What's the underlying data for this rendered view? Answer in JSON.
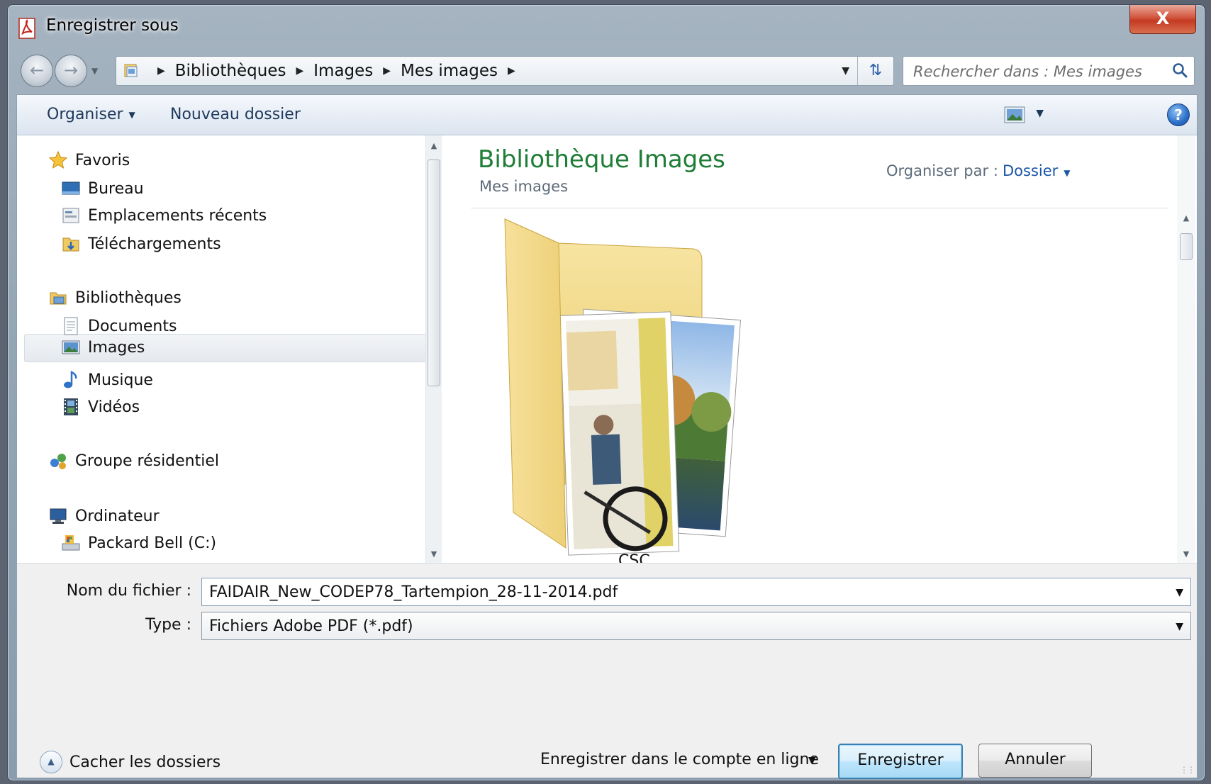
{
  "window": {
    "title": "Enregistrer sous",
    "close_label": "X"
  },
  "breadcrumb": [
    "Bibliothèques",
    "Images",
    "Mes images"
  ],
  "search": {
    "placeholder": "Rechercher dans : Mes images"
  },
  "toolbar": {
    "organize_label": "Organiser",
    "new_folder_label": "Nouveau dossier",
    "help_label": "?"
  },
  "nav": {
    "favorites": "Favoris",
    "desktop": "Bureau",
    "recent": "Emplacements récents",
    "downloads": "Téléchargements",
    "libraries": "Bibliothèques",
    "documents": "Documents",
    "images": "Images",
    "music": "Musique",
    "videos": "Vidéos",
    "homegroup": "Groupe résidentiel",
    "computer": "Ordinateur",
    "drive_c": "Packard Bell (C:)",
    "selected": "Images"
  },
  "library": {
    "title": "Bibliothèque Images",
    "subtitle": "Mes images",
    "arrange_label": "Organiser par :",
    "arrange_value": "Dossier",
    "folder_label": "CSC"
  },
  "form": {
    "filename_label": "Nom du fichier :",
    "filename_value": "FAIDAIR_New_CODEP78_Tartempion_28-11-2014.pdf",
    "type_label": "Type :",
    "type_value": "Fichiers Adobe PDF (*.pdf)"
  },
  "footer": {
    "hide_folders_label": "Cacher les dossiers",
    "online_save_label": "Enregistrer dans le compte en ligne",
    "save_label": "Enregistrer",
    "cancel_label": "Annuler"
  },
  "colors": {
    "library_title": "#1e7d36",
    "link_blue": "#1a55a5",
    "close_red": "#c43a22",
    "primary_button_border": "#3c7fb1"
  },
  "icons": {
    "title": "pdf-icon",
    "favorites": "star-icon",
    "desktop": "desktop-icon",
    "recent": "recent-places-icon",
    "downloads": "downloads-folder-icon",
    "libraries": "libraries-icon",
    "documents": "document-icon",
    "images": "images-icon",
    "music": "music-note-icon",
    "videos": "film-icon",
    "homegroup": "homegroup-icon",
    "computer": "computer-icon",
    "drive": "drive-icon",
    "search": "search-icon",
    "help": "help-icon",
    "refresh": "refresh-icon",
    "view": "view-options-icon"
  }
}
